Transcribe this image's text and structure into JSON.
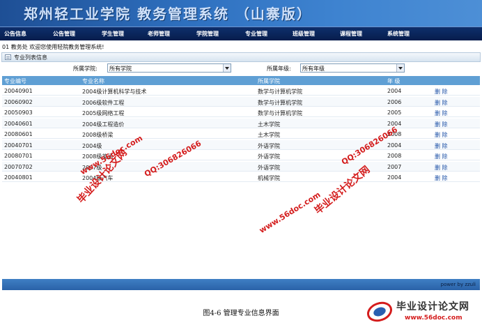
{
  "app": {
    "title": "郑州轻工业学院  教务管理系统  （山寨版）",
    "welcome": "01 教务处 欢迎您使用轻院教务管理系统!"
  },
  "nav": [
    "公告信息",
    "公告管理",
    "学生管理",
    "老师管理",
    "学院管理",
    "专业管理",
    "班级管理",
    "课程管理",
    "系统管理"
  ],
  "panel": {
    "title": "专业列表信息"
  },
  "filters": {
    "college_label": "所属学院:",
    "college_value": "所有学院",
    "grade_label": "所属年级:",
    "grade_value": "所有年级"
  },
  "table": {
    "headers": [
      "专业编号",
      "专业名称",
      "所属学院",
      "年 级"
    ],
    "action_label": "删 除",
    "rows": [
      [
        "20040901",
        "2004级计算机科学与技术",
        "数学与计算机学院",
        "2004"
      ],
      [
        "20060902",
        "2006级软件工程",
        "数学与计算机学院",
        "2006"
      ],
      [
        "20050903",
        "2005级网络工程",
        "数学与计算机学院",
        "2005"
      ],
      [
        "20040601",
        "2004级工程造价",
        "土木学院",
        "2004"
      ],
      [
        "20080601",
        "2008级桥梁",
        "土木学院",
        "2008"
      ],
      [
        "20040701",
        "2004级",
        "外语学院",
        "2004"
      ],
      [
        "20080701",
        "2008级英语",
        "外语学院",
        "2008"
      ],
      [
        "20070702",
        "2007级",
        "外语学院",
        "2007"
      ],
      [
        "20040801",
        "2004级汽车",
        "机械学院",
        "2004"
      ]
    ]
  },
  "footer": {
    "text": "power by zzuli"
  },
  "caption": "图4-6  管理专业信息界面",
  "watermarks": {
    "site_name": "毕业设计论文网",
    "qq": "QQ:306826066",
    "url": "www.56doc.com"
  },
  "logo": {
    "name": "毕业设计论文网",
    "url": "www.56doc.com"
  }
}
